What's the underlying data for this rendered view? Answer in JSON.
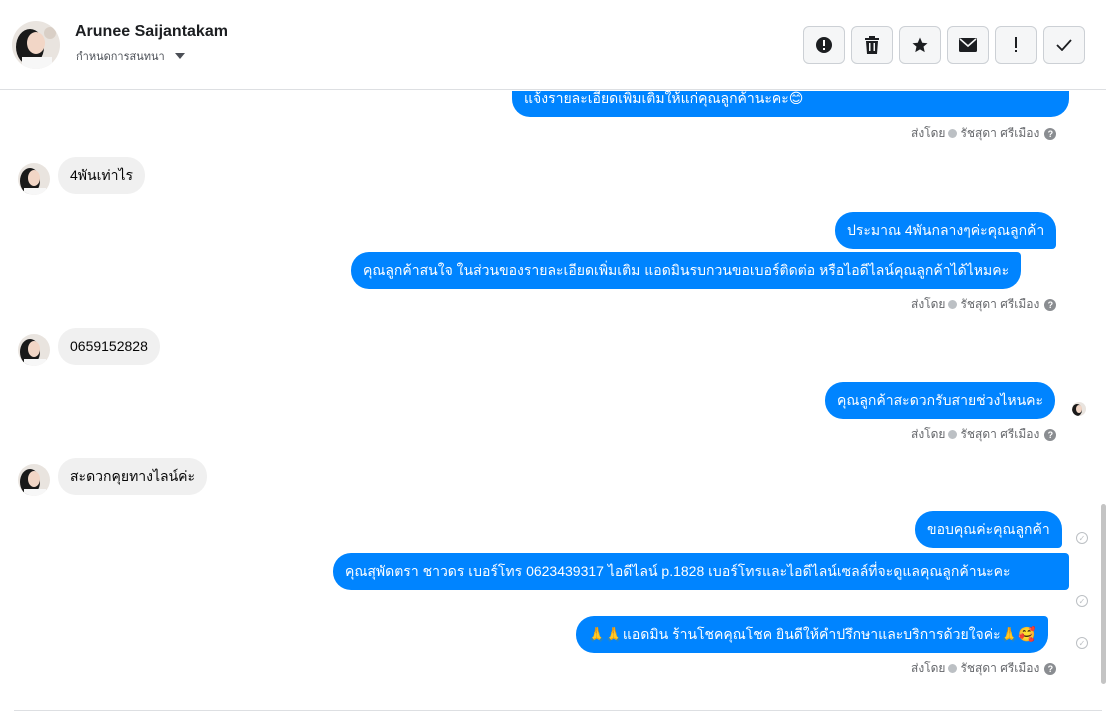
{
  "header": {
    "contact_name": "Arunee Saijantakam",
    "assign_label": "กำหนดการสนทนา",
    "actions": [
      {
        "icon": "alert-circle-icon",
        "label": "mark-spam"
      },
      {
        "icon": "trash-icon",
        "label": "delete"
      },
      {
        "icon": "star-icon",
        "label": "star"
      },
      {
        "icon": "envelope-icon",
        "label": "mark-unread"
      },
      {
        "icon": "exclamation-icon",
        "label": "follow-up"
      },
      {
        "icon": "check-icon",
        "label": "done"
      }
    ]
  },
  "messages": [
    {
      "dir": "out",
      "text": "แจ้งรายละเอียดเพิ่มเติมให้แก่คุณลูกค้านะคะ😊"
    },
    {
      "dir": "in",
      "text": "4พันเท่าไร"
    },
    {
      "dir": "out",
      "text": "ประมาณ 4พันกลางๆค่ะคุณลูกค้า"
    },
    {
      "dir": "out",
      "text": "คุณลูกค้าสนใจ ในส่วนของรายละเอียดเพิ่มเติม แอดมินรบกวนขอเบอร์ติดต่อ หรือไอดีไลน์คุณลูกค้าได้ไหมคะ"
    },
    {
      "dir": "in",
      "text": "0659152828"
    },
    {
      "dir": "out",
      "text": "คุณลูกค้าสะดวกรับสายช่วงไหนคะ"
    },
    {
      "dir": "in",
      "text": "สะดวกคุยทางไลน์ค่ะ"
    },
    {
      "dir": "out",
      "text": "ขอบคุณค่ะคุณลูกค้า"
    },
    {
      "dir": "out",
      "text": "คุณสุพัดตรา   ชาวดร      เบอร์โทร 0623439317  ไอดีไลน์ p.1828   เบอร์โทรและไอดีไลน์เซลล์ที่จะดูแลคุณลูกค้านะคะ"
    },
    {
      "dir": "out",
      "text": "🙏🙏แอดมิน ร้านโชคคุณโชค ยินดีให้คำปรึกษาและบริการด้วยใจค่ะ🙏🥰"
    }
  ],
  "sent_by": {
    "prefix": "ส่งโดย",
    "agent": "รัชสุดา ศรีเมือง",
    "help": "?"
  },
  "colors": {
    "outgoing_bubble": "#0084ff",
    "incoming_bubble": "#f0f0f0"
  }
}
